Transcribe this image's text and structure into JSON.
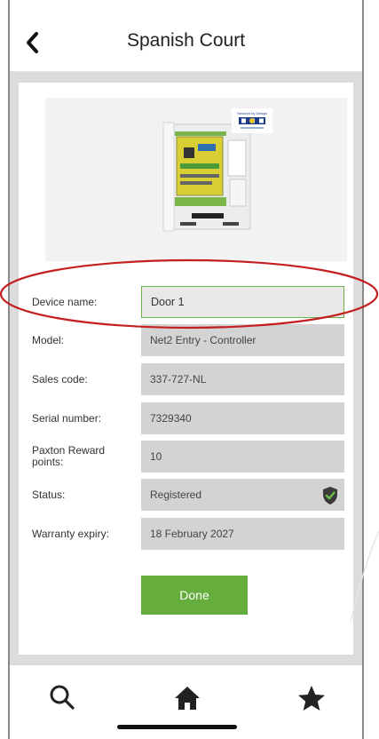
{
  "header": {
    "title": "Spanish Court",
    "back_icon": "chevron-left-icon"
  },
  "device_image": {
    "badge_text": "Secured by Design"
  },
  "fields": [
    {
      "label": "Device name:",
      "value": "Door 1",
      "editable": true
    },
    {
      "label": "Model:",
      "value": "Net2 Entry - Controller",
      "editable": false
    },
    {
      "label": "Sales code:",
      "value": "337-727-NL",
      "editable": false
    },
    {
      "label": "Serial number:",
      "value": "7329340",
      "editable": false
    },
    {
      "label": "Paxton Reward points:",
      "value": "10",
      "editable": false
    },
    {
      "label": "Status:",
      "value": "Registered",
      "editable": false,
      "status_icon": "shield-check-icon"
    },
    {
      "label": "Warranty expiry:",
      "value": "18 February 2027",
      "editable": false
    }
  ],
  "done_button": {
    "label": "Done"
  },
  "tabbar": {
    "items": [
      {
        "icon": "search-icon"
      },
      {
        "icon": "home-icon"
      },
      {
        "icon": "star-icon"
      }
    ]
  },
  "colors": {
    "accent_green": "#65ad3c",
    "highlight_ellipse": "#c41e1e",
    "field_gray": "#d3d3d3",
    "content_bg": "#dcdcdc"
  }
}
